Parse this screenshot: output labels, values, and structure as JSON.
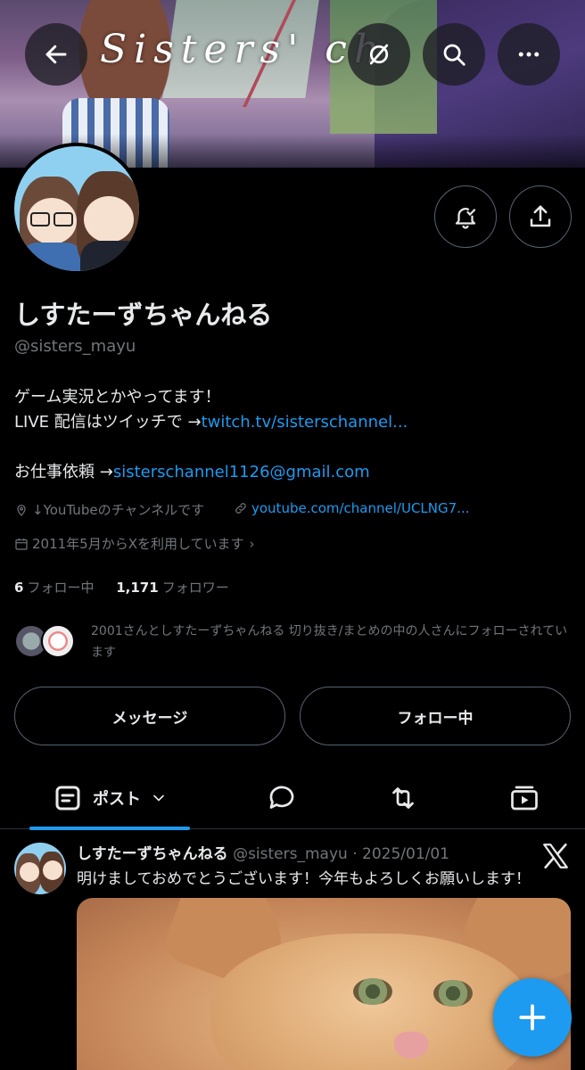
{
  "banner": {
    "title": "Sisters' ch",
    "back_icon": "arrow-left-icon",
    "grok_icon": "grok-icon",
    "search_icon": "search-icon",
    "more_icon": "more-horizontal-icon"
  },
  "profile": {
    "name": "しすたーずちゃんねる",
    "handle": "@sisters_mayu",
    "bio_line1": "ゲーム実況とかやってます！",
    "bio_line2_prefix": "LIVE 配信はツイッチで →",
    "bio_line2_link": "twitch.tv/sisterschannel...",
    "bio_line3_prefix": "お仕事依頼 →",
    "bio_line3_link": "sisterschannel1126@gmail.com",
    "location": "↓YouTubeのチャンネルです",
    "website": "youtube.com/channel/UCLNG7...",
    "joined": "2011年5月からXを利用しています",
    "following_count": "6",
    "following_label": "フォロー中",
    "followers_count": "1,171",
    "followers_label": "フォロワー",
    "followed_by_text": "2001さんとしすたーずちゃんねる 切り抜き/まとめの中の人さんにフォローされています"
  },
  "actions": {
    "notify_icon": "bell-check-icon",
    "share_icon": "share-icon",
    "message_label": "メッセージ",
    "following_button_label": "フォロー中"
  },
  "tabs": {
    "posts_label": "ポスト",
    "replies_icon": "reply-icon",
    "reposts_icon": "repost-icon",
    "media_icon": "media-icon"
  },
  "post": {
    "name": "しすたーずちゃんねる",
    "handle_date": "@sisters_mayu · 2025/01/01",
    "text": "明けましておめでとうございます！今年もよろしくお願いします！",
    "x_logo": "x-logo-icon"
  },
  "fab": {
    "icon": "plus-icon"
  },
  "colors": {
    "accent": "#1d9bf0",
    "muted": "#71767b",
    "text": "#e7e9ea",
    "background": "#000000"
  }
}
